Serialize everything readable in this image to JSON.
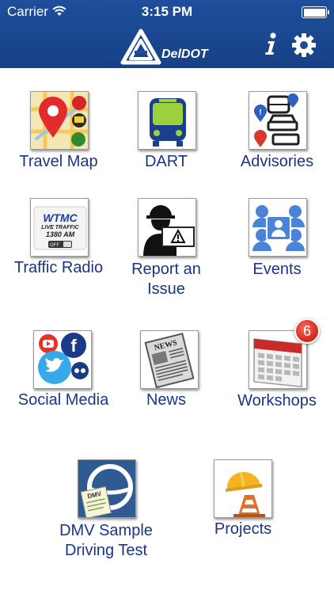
{
  "status_bar": {
    "carrier": "Carrier",
    "time": "3:15 PM"
  },
  "header": {
    "logo_text": "DelDOT"
  },
  "colors": {
    "header": "#1e4f9c",
    "label": "#1a3585",
    "badge": "#d3251c"
  },
  "tiles": [
    {
      "label": "Travel Map",
      "icon": "map-pin-icon"
    },
    {
      "label": "DART",
      "icon": "bus-icon"
    },
    {
      "label": "Advisories",
      "icon": "vehicles-alert-icon"
    },
    {
      "label": "Traffic Radio",
      "icon": "radio-icon",
      "icon_text": {
        "line1": "WTMC",
        "line2": "LIVE TRAFFIC",
        "line3": "1380 AM",
        "switch": "OFF"
      }
    },
    {
      "label": "Report an\nIssue",
      "icon": "worker-warning-icon"
    },
    {
      "label": "Events",
      "icon": "people-group-icon"
    },
    {
      "label": "Social Media",
      "icon": "social-bubbles-icon"
    },
    {
      "label": "News",
      "icon": "newspaper-icon",
      "icon_text": "NEWS"
    },
    {
      "label": "Workshops",
      "icon": "calendar-icon",
      "badge": "6"
    },
    {
      "label": "DMV Sample\nDriving Test",
      "icon": "steering-wheel-icon",
      "icon_text": "DMV"
    },
    {
      "label": "Projects",
      "icon": "hardhat-cone-icon"
    }
  ]
}
